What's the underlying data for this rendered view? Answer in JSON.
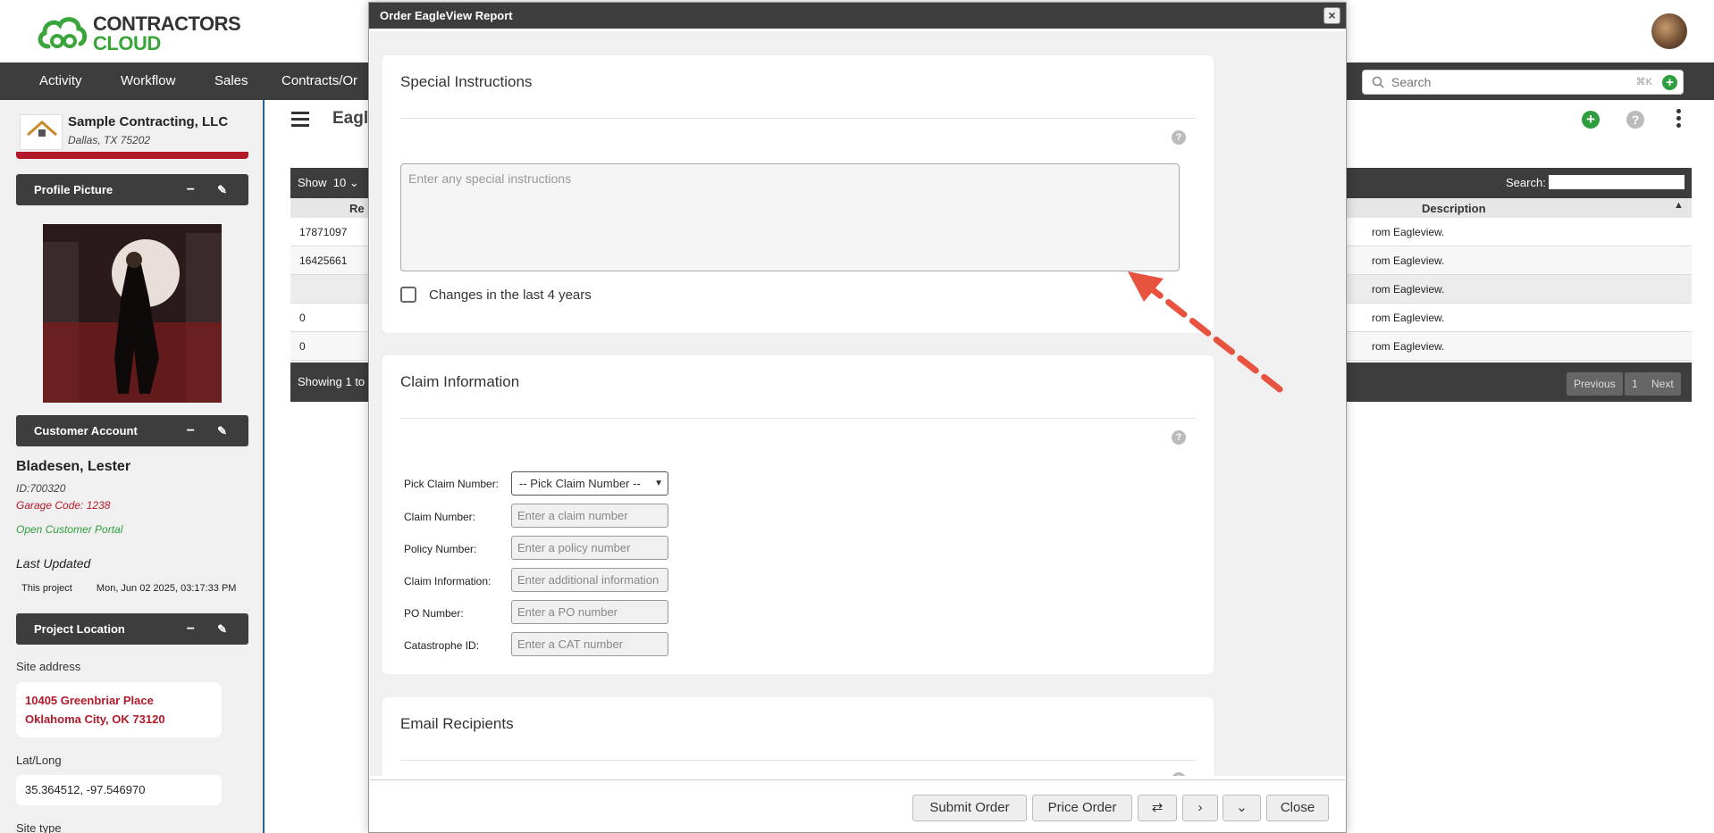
{
  "header": {
    "logo_line1": "CONTRACTORS",
    "logo_line2": "CLOUD",
    "nav": [
      {
        "label": "Activity"
      },
      {
        "label": "Workflow"
      },
      {
        "label": "Sales"
      },
      {
        "label": "Contracts/Or"
      }
    ],
    "search": {
      "placeholder": "Search",
      "shortcut": "⌘K"
    },
    "avatar_icon": "user-avatar"
  },
  "sidebar": {
    "company_name": "Sample Contracting, LLC",
    "company_city": "Dallas, TX 75202",
    "company_logo_text": "Sample Contracting",
    "profile_panel": "Profile Picture",
    "customer_panel": "Customer Account",
    "customer_name": "Bladesen, Lester",
    "customer_id": "ID:700320",
    "garage_code": "Garage Code: 1238",
    "portal_link": "Open Customer Portal",
    "last_updated_label": "Last Updated",
    "last_updated_scope": "This project",
    "last_updated_value": "Mon, Jun 02 2025, 03:17:33 PM",
    "location_panel": "Project Location",
    "site_address_label": "Site address",
    "address_line1": "10405 Greenbriar Place",
    "address_line2": "Oklahoma City, OK 73120",
    "latlong_label": "Lat/Long",
    "latlong_value": "35.364512, -97.546970",
    "site_type_label": "Site type"
  },
  "main": {
    "title": "Eagl",
    "table": {
      "show_label": "Show",
      "show_value": "10",
      "search_label": "Search:",
      "col_rep": "Re",
      "col_description": "Description",
      "rows": [
        {
          "id": "17871097",
          "desc": "rom Eagleview."
        },
        {
          "id": "16425661",
          "desc": "rom Eagleview."
        },
        {
          "id": "",
          "desc": "rom Eagleview."
        },
        {
          "id": "0",
          "desc": "rom Eagleview."
        },
        {
          "id": "0",
          "desc": "rom Eagleview."
        }
      ],
      "showing": "Showing 1 to",
      "pager": {
        "previous": "Previous",
        "page": "1",
        "next": "Next"
      }
    }
  },
  "modal": {
    "title": "Order EagleView Report",
    "special": {
      "title": "Special Instructions",
      "placeholder": "Enter any special instructions",
      "checkbox_label": "Changes in the last 4 years"
    },
    "claim": {
      "title": "Claim Information",
      "pick_label": "Pick Claim Number:",
      "pick_value": "-- Pick Claim Number --",
      "fields": [
        {
          "label": "Claim Number:",
          "placeholder": "Enter a claim number"
        },
        {
          "label": "Policy Number:",
          "placeholder": "Enter a policy number"
        },
        {
          "label": "Claim Information:",
          "placeholder": "Enter additional information"
        },
        {
          "label": "PO Number:",
          "placeholder": "Enter a PO number"
        },
        {
          "label": "Catastrophe ID:",
          "placeholder": "Enter a CAT number"
        }
      ]
    },
    "email": {
      "title": "Email Recipients"
    },
    "footer": {
      "submit": "Submit Order",
      "price": "Price Order",
      "swap": "⇄",
      "next": "›",
      "down": "⌄",
      "close": "Close"
    }
  },
  "colors": {
    "accent_green": "#2f9e3f",
    "accent_red": "#b21a2a",
    "bar_dark": "#3d3d3d",
    "arrow": "#e8533f"
  }
}
